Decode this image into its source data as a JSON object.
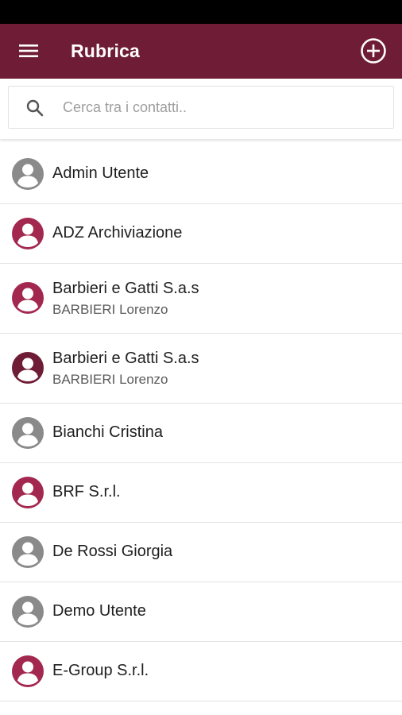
{
  "app_bar": {
    "title": "Rubrica",
    "background_color": "#6f1d36",
    "menu_icon": "hamburger-menu-icon",
    "add_icon": "add-circle-icon"
  },
  "search": {
    "placeholder": "Cerca tra i contatti..",
    "value": "",
    "icon": "search-icon"
  },
  "avatar_colors": {
    "grey": "#8a8a8a",
    "rose": "#a3284f",
    "dark": "#6f1d36"
  },
  "contacts": [
    {
      "name": "Admin Utente",
      "subtitle": "",
      "avatar_color": "grey"
    },
    {
      "name": "ADZ Archiviazione",
      "subtitle": "",
      "avatar_color": "rose"
    },
    {
      "name": "Barbieri e Gatti S.a.s",
      "subtitle": "BARBIERI Lorenzo",
      "avatar_color": "rose"
    },
    {
      "name": "Barbieri e Gatti S.a.s",
      "subtitle": "BARBIERI Lorenzo",
      "avatar_color": "dark"
    },
    {
      "name": "Bianchi Cristina",
      "subtitle": "",
      "avatar_color": "grey"
    },
    {
      "name": "BRF S.r.l.",
      "subtitle": "",
      "avatar_color": "rose"
    },
    {
      "name": "De Rossi Giorgia",
      "subtitle": "",
      "avatar_color": "grey"
    },
    {
      "name": "Demo Utente",
      "subtitle": "",
      "avatar_color": "grey"
    },
    {
      "name": "E-Group S.r.l.",
      "subtitle": "",
      "avatar_color": "rose"
    }
  ]
}
